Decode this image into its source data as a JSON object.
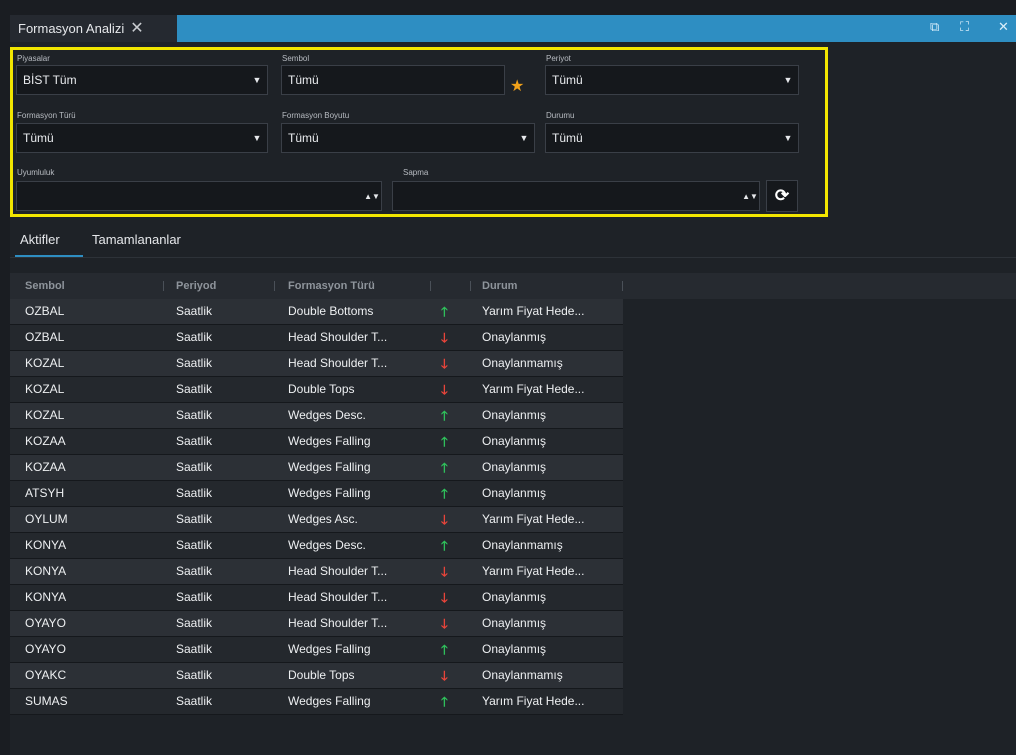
{
  "window": {
    "tab_title": "Formasyon Analizi",
    "close_glyph": "✕",
    "restore_glyph": "⧉",
    "expand_glyph": "⛶",
    "close_window_glyph": "✕"
  },
  "filters": {
    "piyasalar": {
      "label": "Piyasalar",
      "value": "BİST Tüm"
    },
    "sembol": {
      "label": "Sembol",
      "value": "Tümü"
    },
    "periyot": {
      "label": "Periyot",
      "value": "Tümü"
    },
    "formasyon_turu": {
      "label": "Formasyon Türü",
      "value": "Tümü"
    },
    "formasyon_boyutu": {
      "label": "Formasyon Boyutu",
      "value": "Tümü"
    },
    "durumu": {
      "label": "Durumu",
      "value": "Tümü"
    },
    "uyumluluk": {
      "label": "Uyumluluk",
      "value": ""
    },
    "sapma": {
      "label": "Sapma",
      "value": ""
    },
    "caret": "▼",
    "spin_glyph": "▲▼",
    "star_glyph": "★",
    "refresh_glyph": "⟳"
  },
  "subtabs": {
    "active": "Aktifler",
    "completed": "Tamamlananlar"
  },
  "table": {
    "columns": {
      "sembol": "Sembol",
      "periyod": "Periyod",
      "formasyon_turu": "Formasyon Türü",
      "durum": "Durum"
    },
    "rows": [
      {
        "sembol": "OZBAL",
        "periyod": "Saatlik",
        "formasyon": "Double Bottoms",
        "direction": "up",
        "durum": "Yarım Fiyat Hede..."
      },
      {
        "sembol": "OZBAL",
        "periyod": "Saatlik",
        "formasyon": "Head Shoulder T...",
        "direction": "down",
        "durum": "Onaylanmış"
      },
      {
        "sembol": "KOZAL",
        "periyod": "Saatlik",
        "formasyon": "Head Shoulder T...",
        "direction": "down",
        "durum": "Onaylanmamış"
      },
      {
        "sembol": "KOZAL",
        "periyod": "Saatlik",
        "formasyon": "Double Tops",
        "direction": "down",
        "durum": "Yarım Fiyat Hede..."
      },
      {
        "sembol": "KOZAL",
        "periyod": "Saatlik",
        "formasyon": "Wedges Desc.",
        "direction": "up",
        "durum": "Onaylanmış"
      },
      {
        "sembol": "KOZAA",
        "periyod": "Saatlik",
        "formasyon": "Wedges Falling",
        "direction": "up",
        "durum": "Onaylanmış"
      },
      {
        "sembol": "KOZAA",
        "periyod": "Saatlik",
        "formasyon": "Wedges Falling",
        "direction": "up",
        "durum": "Onaylanmış"
      },
      {
        "sembol": "ATSYH",
        "periyod": "Saatlik",
        "formasyon": "Wedges Falling",
        "direction": "up",
        "durum": "Onaylanmış"
      },
      {
        "sembol": "OYLUM",
        "periyod": "Saatlik",
        "formasyon": "Wedges Asc.",
        "direction": "down",
        "durum": "Yarım Fiyat Hede..."
      },
      {
        "sembol": "KONYA",
        "periyod": "Saatlik",
        "formasyon": "Wedges Desc.",
        "direction": "up",
        "durum": "Onaylanmamış"
      },
      {
        "sembol": "KONYA",
        "periyod": "Saatlik",
        "formasyon": "Head Shoulder T...",
        "direction": "down",
        "durum": "Yarım Fiyat Hede..."
      },
      {
        "sembol": "KONYA",
        "periyod": "Saatlik",
        "formasyon": "Head Shoulder T...",
        "direction": "down",
        "durum": "Onaylanmış"
      },
      {
        "sembol": "OYAYO",
        "periyod": "Saatlik",
        "formasyon": "Head Shoulder T...",
        "direction": "down",
        "durum": "Onaylanmış"
      },
      {
        "sembol": "OYAYO",
        "periyod": "Saatlik",
        "formasyon": "Wedges Falling",
        "direction": "up",
        "durum": "Onaylanmış"
      },
      {
        "sembol": "OYAKC",
        "periyod": "Saatlik",
        "formasyon": "Double Tops",
        "direction": "down",
        "durum": "Onaylanmamış"
      },
      {
        "sembol": "SUMAS",
        "periyod": "Saatlik",
        "formasyon": "Wedges Falling",
        "direction": "up",
        "durum": "Yarım Fiyat Hede..."
      }
    ]
  },
  "icons": {
    "up": "🡑",
    "down": "🡓"
  },
  "colors": {
    "accent": "#2e8ec2",
    "highlight": "#f2e600",
    "up": "#2fbf5b",
    "down": "#e8443a",
    "star": "#f0a11a"
  }
}
